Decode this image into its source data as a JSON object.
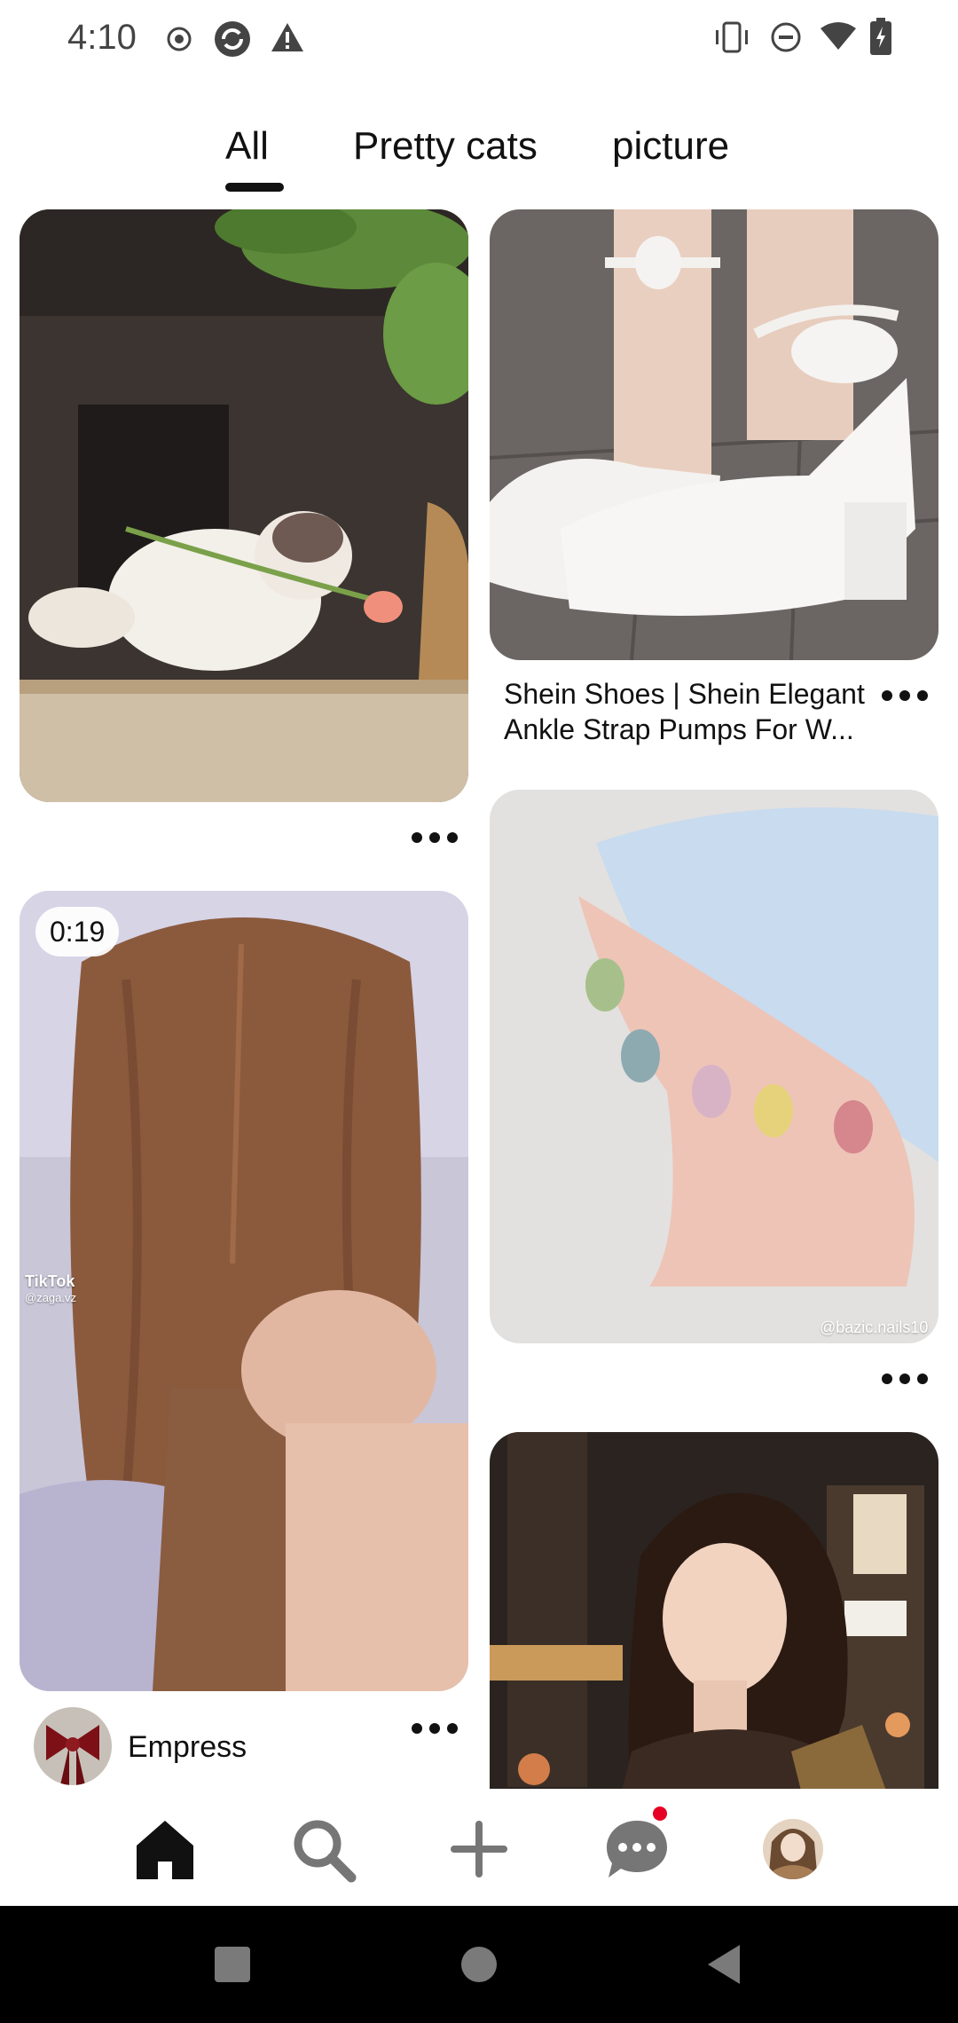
{
  "status_bar": {
    "time": "4:10",
    "left_icons": [
      "record-icon",
      "sync-icon",
      "warning-icon"
    ],
    "right_icons": [
      "vibrate-icon",
      "do-not-disturb-icon",
      "wifi-icon",
      "battery-charging-icon"
    ]
  },
  "tabs": [
    {
      "label": "All",
      "selected": true
    },
    {
      "label": "Pretty cats",
      "selected": false
    },
    {
      "label": "picture",
      "selected": false
    }
  ],
  "pins": {
    "cat": {
      "image": "cat-with-tulip-image"
    },
    "shoes": {
      "image": "white-heels-image",
      "title": "Shein Shoes | Shein Elegant Ankle Strap Pumps For W..."
    },
    "hair": {
      "image": "hair-braiding-video-image",
      "duration": "0:19",
      "watermark": "TikTok",
      "watermark_handle": "@zaga.vz",
      "creator_name": "Empress"
    },
    "nails": {
      "image": "pastel-nails-image",
      "watermark": "@bazic.nails10"
    },
    "anime": {
      "image": "anime-girl-city-image"
    }
  },
  "bottom_nav": {
    "items": [
      "home-icon",
      "search-icon",
      "create-icon",
      "messages-icon",
      "profile-avatar"
    ],
    "notification_color": "#e60023"
  },
  "system_nav": [
    "recents-button",
    "home-button",
    "back-button"
  ]
}
